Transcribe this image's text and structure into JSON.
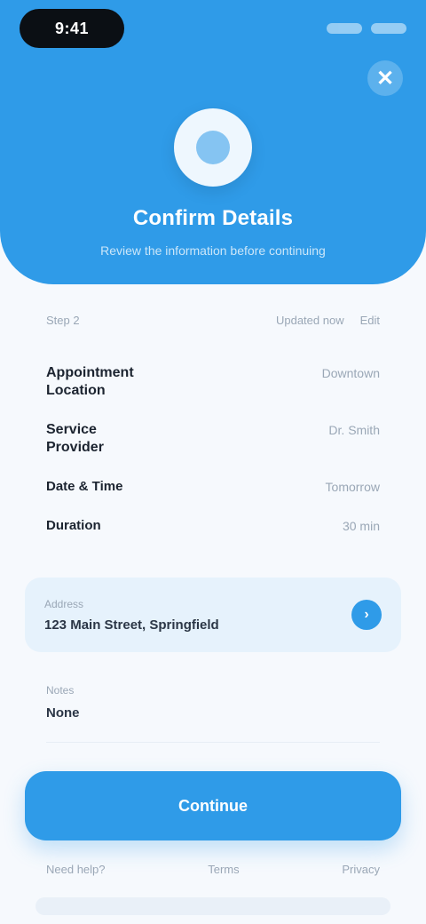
{
  "status": {
    "time": "9:41"
  },
  "header": {
    "close_glyph": "✕",
    "title": "Confirm Details",
    "subtitle": "Review the information before continuing"
  },
  "meta": {
    "left": "Step 2",
    "right_1": "Updated now",
    "right_2": "Edit"
  },
  "details": [
    {
      "label": "Appointment\nLocation",
      "value": "Downtown"
    },
    {
      "label": "Service\nProvider",
      "value": "Dr. Smith"
    },
    {
      "label": "Date & Time",
      "value": "Tomorrow"
    },
    {
      "label": "Duration",
      "value": "30 min"
    }
  ],
  "field_primary": {
    "label": "Address",
    "value": "123 Main Street, Springfield",
    "action_glyph": "›"
  },
  "field_secondary": {
    "label": "Notes",
    "value": "None"
  },
  "cta": {
    "label": "Continue"
  },
  "footer": {
    "left": "Need help?",
    "center": "Terms",
    "right": "Privacy"
  },
  "colors": {
    "accent": "#2f9be8",
    "background": "#f6f9fd"
  },
  "icons": {
    "close": "close-icon",
    "avatar": "user-avatar-icon",
    "action": "chevron-right-icon"
  }
}
